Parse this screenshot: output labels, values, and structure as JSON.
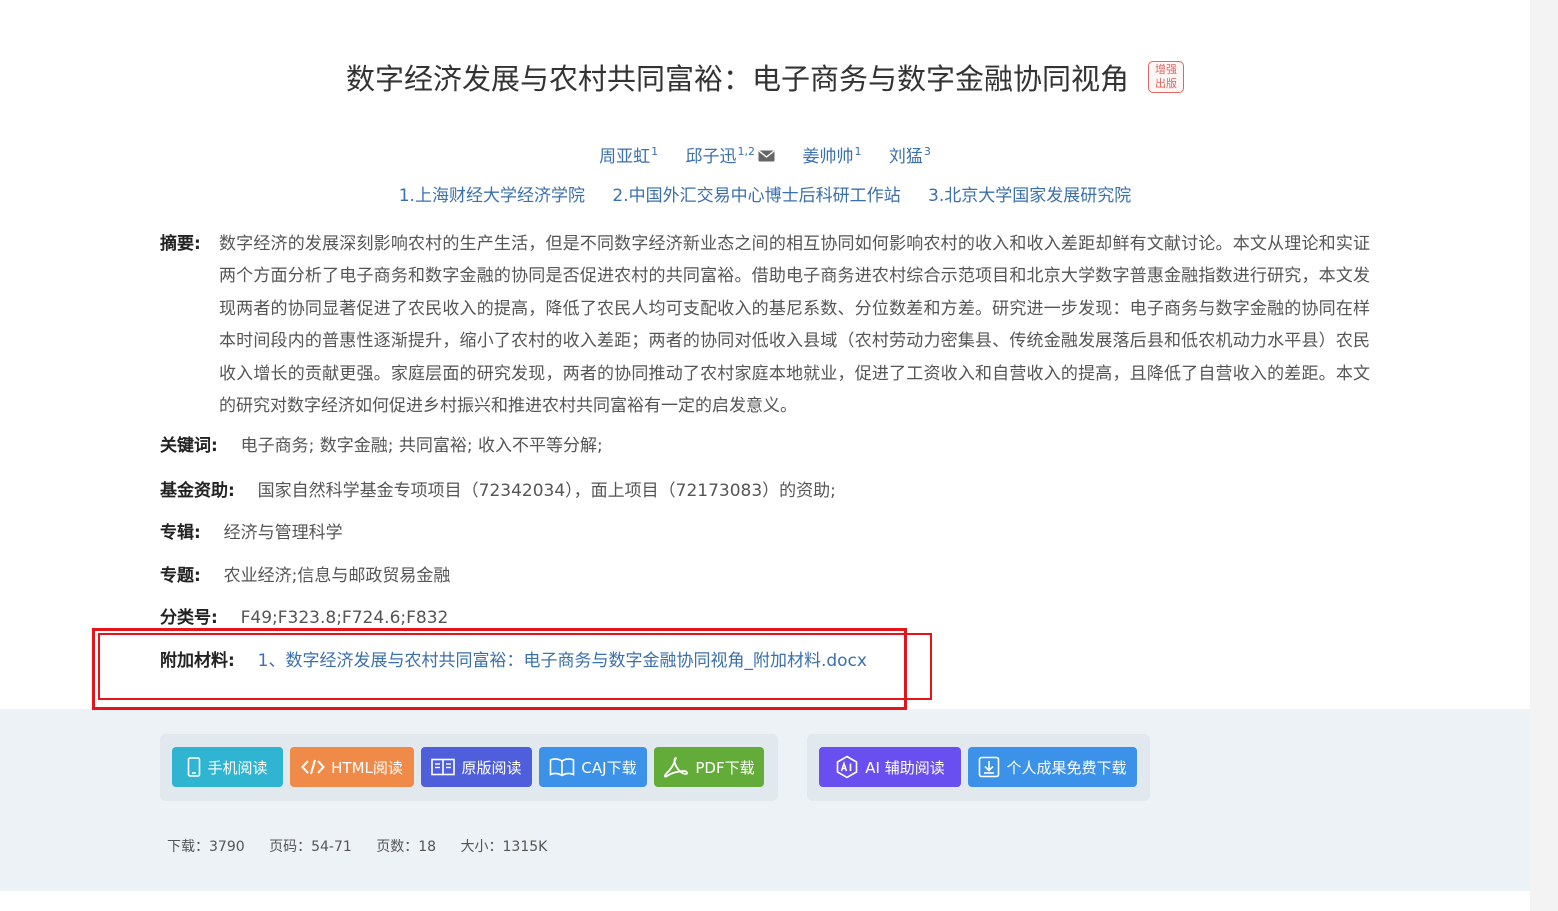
{
  "title": {
    "text": "数字经济发展与农村共同富裕：电子商务与数字金融协同视角",
    "badge_line1": "增强",
    "badge_line2": "出版"
  },
  "authors": [
    {
      "name": "周亚虹",
      "sup": "1"
    },
    {
      "name": "邱子迅",
      "sup": "1,2",
      "has_mail": true
    },
    {
      "name": "姜帅帅",
      "sup": "1"
    },
    {
      "name": "刘猛",
      "sup": "3"
    }
  ],
  "affiliations": [
    "1.上海财经大学经济学院",
    "2.中国外汇交易中心博士后科研工作站",
    "3.北京大学国家发展研究院"
  ],
  "abstract": {
    "label": "摘要:",
    "text": "数字经济的发展深刻影响农村的生产生活，但是不同数字经济新业态之间的相互协同如何影响农村的收入和收入差距却鲜有文献讨论。本文从理论和实证两个方面分析了电子商务和数字金融的协同是否促进农村的共同富裕。借助电子商务进农村综合示范项目和北京大学数字普惠金融指数进行研究，本文发现两者的协同显著促进了农民收入的提高，降低了农民人均可支配收入的基尼系数、分位数差和方差。研究进一步发现：电子商务与数字金融的协同在样本时间段内的普惠性逐渐提升，缩小了农村的收入差距；两者的协同对低收入县域（农村劳动力密集县、传统金融发展落后县和低农机动力水平县）农民收入增长的贡献更强。家庭层面的研究发现，两者的协同推动了农村家庭本地就业，促进了工资收入和自营收入的提高，且降低了自营收入的差距。本文的研究对数字经济如何促进乡村振兴和推进农村共同富裕有一定的启发意义。"
  },
  "keywords": {
    "label": "关键词:",
    "items": [
      "电子商务;",
      "数字金融;",
      "共同富裕;",
      "收入不平等分解;"
    ]
  },
  "fund": {
    "label": "基金资助:",
    "text": "国家自然科学基金专项项目（72342034），面上项目（72173083）的资助;"
  },
  "album": {
    "label": "专辑:",
    "text": "经济与管理科学"
  },
  "topic": {
    "label": "专题:",
    "text": "农业经济;信息与邮政贸易金融"
  },
  "classification": {
    "label": "分类号:",
    "text": "F49;F323.8;F724.6;F832"
  },
  "attachment": {
    "label": "附加材料:",
    "text": "1、数字经济发展与农村共同富裕：电子商务与数字金融协同视角_附加材料.docx"
  },
  "buttons": {
    "mobile": "手机阅读",
    "html": "HTML阅读",
    "original": "原版阅读",
    "caj": "CAJ下载",
    "pdf": "PDF下载",
    "ai": "AI 辅助阅读",
    "free": "个人成果免费下载"
  },
  "stats": {
    "downloads": "下载：3790",
    "pages_range": "页码：54-71",
    "page_count": "页数：18",
    "size": "大小：1315K"
  },
  "colors": {
    "link_blue": "#3a6fb0",
    "highlight_red": "#e5141b",
    "btn_mobile": "#2fb4d2",
    "btn_html": "#f08a48",
    "btn_original": "#4f5fdc",
    "btn_caj": "#3b92e8",
    "btn_pdf": "#63ac3a",
    "btn_ai": "#6a4ff0",
    "btn_free": "#3b92e8"
  },
  "icons": {
    "mail": "mail-icon",
    "mobile": "mobile-icon",
    "html": "code-icon",
    "original": "book-open-icon",
    "caj": "book-icon",
    "pdf": "pdf-icon",
    "ai": "ai-icon",
    "free": "download-icon"
  }
}
